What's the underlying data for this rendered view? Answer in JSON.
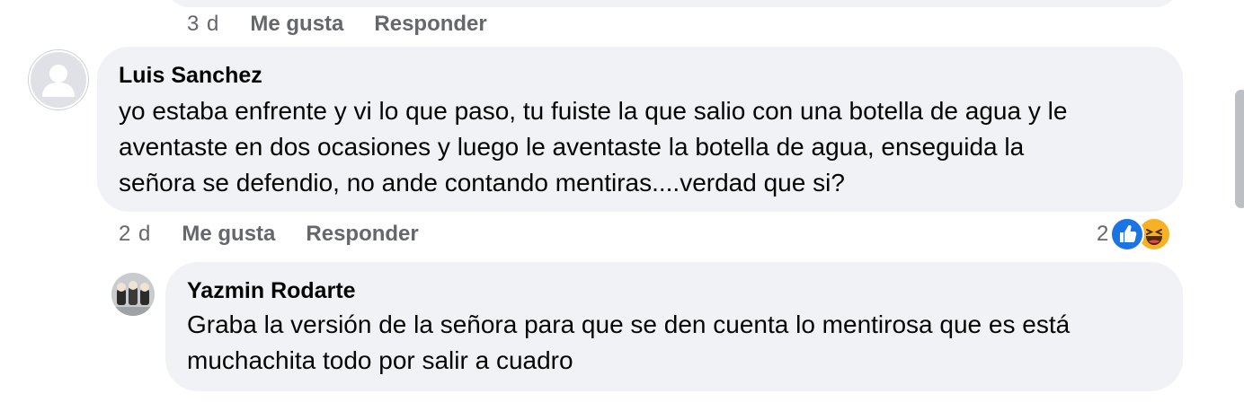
{
  "previous_comment": {
    "time": "3 d",
    "like_label": "Me gusta",
    "reply_label": "Responder"
  },
  "comment": {
    "author": "Luis Sanchez",
    "text_lines": [
      "yo estaba enfrente y vi lo que paso, tu fuiste la que salio con una botella de agua y le",
      "aventaste en dos ocasiones y luego le aventaste la botella de agua, enseguida la",
      "señora se defendio, no ande contando mentiras....verdad que si?"
    ],
    "time": "2 d",
    "like_label": "Me gusta",
    "reply_label": "Responder",
    "reaction_count": "2",
    "reaction_icons": [
      "like-icon",
      "haha-icon"
    ]
  },
  "reply": {
    "author": "Yazmin Rodarte",
    "text_lines": [
      "Graba la versión de la señora para que se den cuenta lo mentirosa que es está",
      "muchachita todo por salir a cuadro"
    ]
  },
  "colors": {
    "bubble": "#f0f2f5",
    "secondary_text": "#65676b",
    "like_blue": "#1b74e4",
    "haha_yellow": "#f7b125"
  }
}
